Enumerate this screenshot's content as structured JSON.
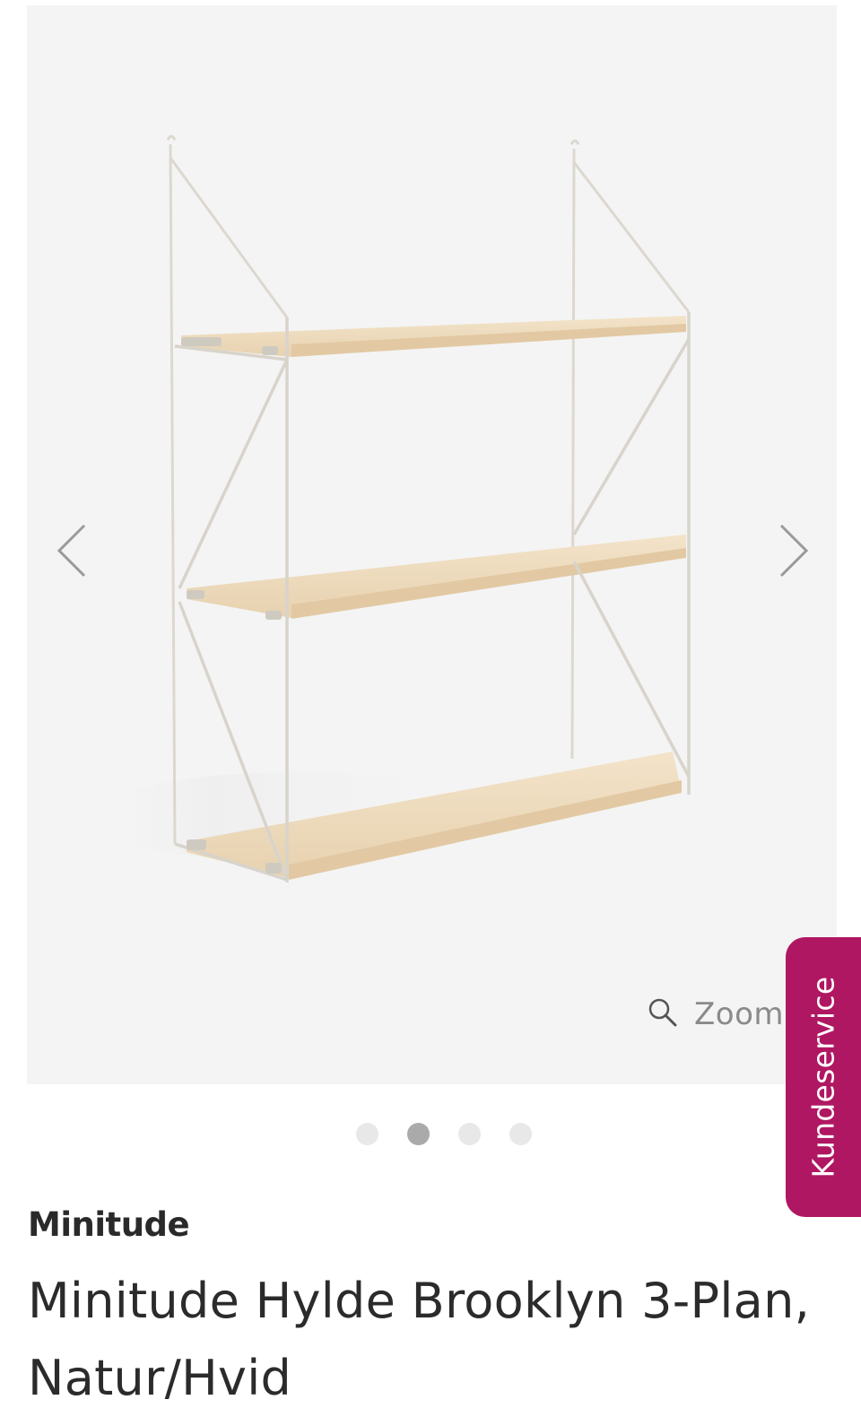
{
  "gallery": {
    "zoom_label": "Zoom",
    "active_dot": 1,
    "dot_count": 4
  },
  "product": {
    "brand": "Minitude",
    "title": "Minitude Hylde Brooklyn 3-Plan, Natur/Hvid"
  },
  "customer_service_tab": {
    "label": "Kundeservice",
    "color": "#b01762"
  },
  "icons": {
    "prev": "chevron-left-icon",
    "next": "chevron-right-icon",
    "zoom": "magnifier-icon"
  }
}
